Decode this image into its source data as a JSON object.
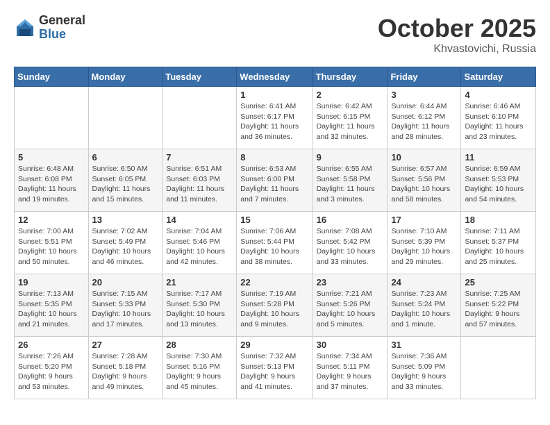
{
  "header": {
    "logo_general": "General",
    "logo_blue": "Blue",
    "month_title": "October 2025",
    "location": "Khvastovichi, Russia"
  },
  "days_of_week": [
    "Sunday",
    "Monday",
    "Tuesday",
    "Wednesday",
    "Thursday",
    "Friday",
    "Saturday"
  ],
  "weeks": [
    [
      {
        "day": "",
        "info": ""
      },
      {
        "day": "",
        "info": ""
      },
      {
        "day": "",
        "info": ""
      },
      {
        "day": "1",
        "info": "Sunrise: 6:41 AM\nSunset: 6:17 PM\nDaylight: 11 hours\nand 36 minutes."
      },
      {
        "day": "2",
        "info": "Sunrise: 6:42 AM\nSunset: 6:15 PM\nDaylight: 11 hours\nand 32 minutes."
      },
      {
        "day": "3",
        "info": "Sunrise: 6:44 AM\nSunset: 6:12 PM\nDaylight: 11 hours\nand 28 minutes."
      },
      {
        "day": "4",
        "info": "Sunrise: 6:46 AM\nSunset: 6:10 PM\nDaylight: 11 hours\nand 23 minutes."
      }
    ],
    [
      {
        "day": "5",
        "info": "Sunrise: 6:48 AM\nSunset: 6:08 PM\nDaylight: 11 hours\nand 19 minutes."
      },
      {
        "day": "6",
        "info": "Sunrise: 6:50 AM\nSunset: 6:05 PM\nDaylight: 11 hours\nand 15 minutes."
      },
      {
        "day": "7",
        "info": "Sunrise: 6:51 AM\nSunset: 6:03 PM\nDaylight: 11 hours\nand 11 minutes."
      },
      {
        "day": "8",
        "info": "Sunrise: 6:53 AM\nSunset: 6:00 PM\nDaylight: 11 hours\nand 7 minutes."
      },
      {
        "day": "9",
        "info": "Sunrise: 6:55 AM\nSunset: 5:58 PM\nDaylight: 11 hours\nand 3 minutes."
      },
      {
        "day": "10",
        "info": "Sunrise: 6:57 AM\nSunset: 5:56 PM\nDaylight: 10 hours\nand 58 minutes."
      },
      {
        "day": "11",
        "info": "Sunrise: 6:59 AM\nSunset: 5:53 PM\nDaylight: 10 hours\nand 54 minutes."
      }
    ],
    [
      {
        "day": "12",
        "info": "Sunrise: 7:00 AM\nSunset: 5:51 PM\nDaylight: 10 hours\nand 50 minutes."
      },
      {
        "day": "13",
        "info": "Sunrise: 7:02 AM\nSunset: 5:49 PM\nDaylight: 10 hours\nand 46 minutes."
      },
      {
        "day": "14",
        "info": "Sunrise: 7:04 AM\nSunset: 5:46 PM\nDaylight: 10 hours\nand 42 minutes."
      },
      {
        "day": "15",
        "info": "Sunrise: 7:06 AM\nSunset: 5:44 PM\nDaylight: 10 hours\nand 38 minutes."
      },
      {
        "day": "16",
        "info": "Sunrise: 7:08 AM\nSunset: 5:42 PM\nDaylight: 10 hours\nand 33 minutes."
      },
      {
        "day": "17",
        "info": "Sunrise: 7:10 AM\nSunset: 5:39 PM\nDaylight: 10 hours\nand 29 minutes."
      },
      {
        "day": "18",
        "info": "Sunrise: 7:11 AM\nSunset: 5:37 PM\nDaylight: 10 hours\nand 25 minutes."
      }
    ],
    [
      {
        "day": "19",
        "info": "Sunrise: 7:13 AM\nSunset: 5:35 PM\nDaylight: 10 hours\nand 21 minutes."
      },
      {
        "day": "20",
        "info": "Sunrise: 7:15 AM\nSunset: 5:33 PM\nDaylight: 10 hours\nand 17 minutes."
      },
      {
        "day": "21",
        "info": "Sunrise: 7:17 AM\nSunset: 5:30 PM\nDaylight: 10 hours\nand 13 minutes."
      },
      {
        "day": "22",
        "info": "Sunrise: 7:19 AM\nSunset: 5:28 PM\nDaylight: 10 hours\nand 9 minutes."
      },
      {
        "day": "23",
        "info": "Sunrise: 7:21 AM\nSunset: 5:26 PM\nDaylight: 10 hours\nand 5 minutes."
      },
      {
        "day": "24",
        "info": "Sunrise: 7:23 AM\nSunset: 5:24 PM\nDaylight: 10 hours\nand 1 minute."
      },
      {
        "day": "25",
        "info": "Sunrise: 7:25 AM\nSunset: 5:22 PM\nDaylight: 9 hours\nand 57 minutes."
      }
    ],
    [
      {
        "day": "26",
        "info": "Sunrise: 7:26 AM\nSunset: 5:20 PM\nDaylight: 9 hours\nand 53 minutes."
      },
      {
        "day": "27",
        "info": "Sunrise: 7:28 AM\nSunset: 5:18 PM\nDaylight: 9 hours\nand 49 minutes."
      },
      {
        "day": "28",
        "info": "Sunrise: 7:30 AM\nSunset: 5:16 PM\nDaylight: 9 hours\nand 45 minutes."
      },
      {
        "day": "29",
        "info": "Sunrise: 7:32 AM\nSunset: 5:13 PM\nDaylight: 9 hours\nand 41 minutes."
      },
      {
        "day": "30",
        "info": "Sunrise: 7:34 AM\nSunset: 5:11 PM\nDaylight: 9 hours\nand 37 minutes."
      },
      {
        "day": "31",
        "info": "Sunrise: 7:36 AM\nSunset: 5:09 PM\nDaylight: 9 hours\nand 33 minutes."
      },
      {
        "day": "",
        "info": ""
      }
    ]
  ]
}
